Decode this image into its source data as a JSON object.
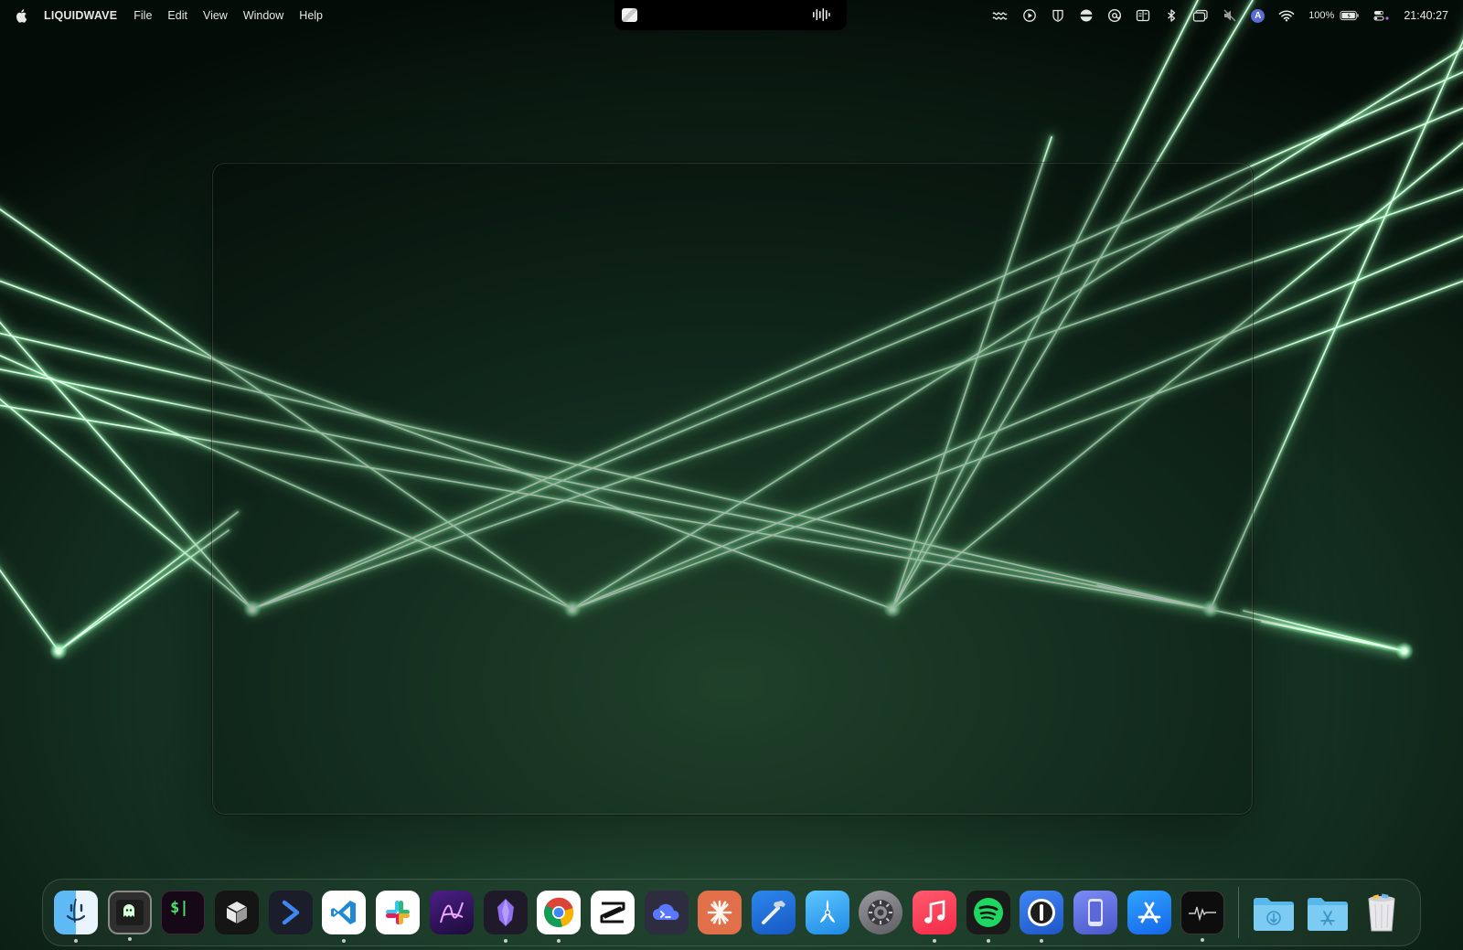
{
  "menubar": {
    "app_name": "LIQUIDWAVE",
    "menus": [
      "File",
      "Edit",
      "View",
      "Window",
      "Help"
    ],
    "battery_percent": "100%",
    "clock": "21:40:27",
    "status_icons": [
      "wave-icon",
      "play-circle-icon",
      "shield-icon",
      "stripes-icon",
      "at-sign-icon",
      "split-view-icon",
      "bluetooth-icon",
      "window-icon",
      "mute-icon",
      "input-source-icon",
      "wifi-icon",
      "battery-icon",
      "control-center-icon"
    ],
    "input_source_label": "A"
  },
  "now_playing": {
    "art_icon": "album-art-icon",
    "wave_icon": "audio-wave-icon"
  },
  "dock": {
    "apps": [
      {
        "name": "Finder",
        "icon": "finder-icon",
        "running": true
      },
      {
        "name": "Ghostty",
        "icon": "ghost-terminal-icon",
        "running": true
      },
      {
        "name": "Terminal",
        "icon": "dollar-terminal-icon",
        "running": false
      },
      {
        "name": "Cube App",
        "icon": "cube-icon",
        "running": false
      },
      {
        "name": "Shell Runner",
        "icon": "chevron-right-icon",
        "running": false
      },
      {
        "name": "Visual Studio Code",
        "icon": "vscode-icon",
        "running": true
      },
      {
        "name": "Slack",
        "icon": "slack-icon",
        "running": false
      },
      {
        "name": "Design App",
        "icon": "vector-pen-icon",
        "running": false
      },
      {
        "name": "Obsidian",
        "icon": "obsidian-icon",
        "running": true
      },
      {
        "name": "Google Chrome",
        "icon": "chrome-icon",
        "running": true
      },
      {
        "name": "CapCut",
        "icon": "capcut-icon",
        "running": false
      },
      {
        "name": "SSH Client",
        "icon": "cloud-terminal-icon",
        "running": false
      },
      {
        "name": "Claude",
        "icon": "asterisk-burst-icon",
        "running": false
      },
      {
        "name": "Xcode",
        "icon": "hammer-icon",
        "running": false
      },
      {
        "name": "TestFlight",
        "icon": "propeller-icon",
        "running": false
      },
      {
        "name": "System Settings",
        "icon": "gear-icon",
        "running": false
      },
      {
        "name": "Music",
        "icon": "music-note-icon",
        "running": true
      },
      {
        "name": "Spotify",
        "icon": "spotify-icon",
        "running": true
      },
      {
        "name": "1Password",
        "icon": "password-key-icon",
        "running": true
      },
      {
        "name": "iPhone Mirroring",
        "icon": "phone-icon",
        "running": false
      },
      {
        "name": "App Store",
        "icon": "app-store-icon",
        "running": false
      },
      {
        "name": "Activity Monitor",
        "icon": "activity-wave-icon",
        "running": true
      }
    ],
    "stacks": [
      {
        "name": "Downloads",
        "icon": "downloads-folder-icon"
      },
      {
        "name": "Applications",
        "icon": "applications-folder-icon"
      },
      {
        "name": "Trash",
        "icon": "trash-icon"
      }
    ]
  },
  "colors": {
    "laser": "#8cf5a6",
    "laser_core": "#e9fff0",
    "background_dark": "#051009",
    "background_glow": "#2a5a3a"
  }
}
